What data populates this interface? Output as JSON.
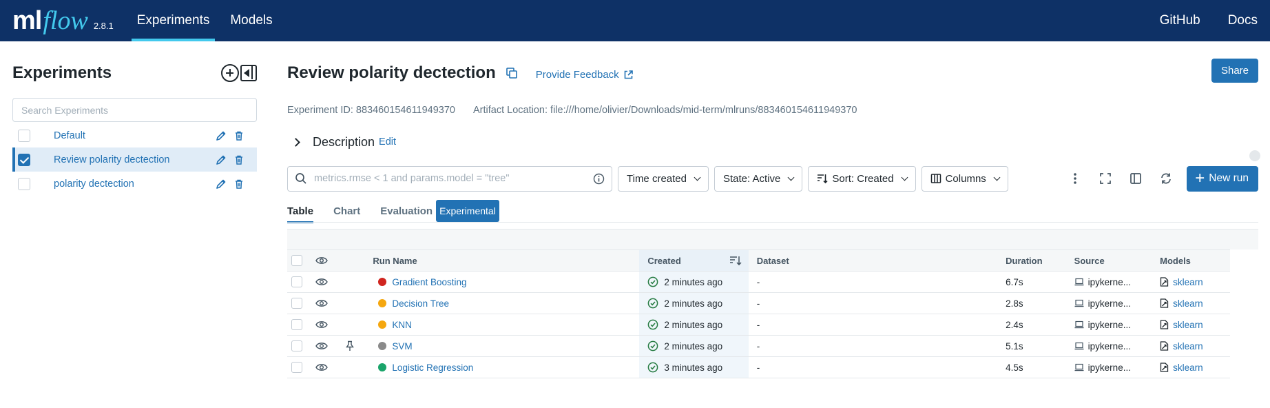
{
  "app": {
    "logo_ml": "ml",
    "logo_flow": "flow",
    "version": "2.8.1",
    "nav": [
      {
        "label": "Experiments",
        "active": true
      },
      {
        "label": "Models",
        "active": false
      }
    ],
    "links": {
      "github": "GitHub",
      "docs": "Docs"
    }
  },
  "sidebar": {
    "title": "Experiments",
    "search_placeholder": "Search Experiments",
    "experiments": [
      {
        "name": "Default",
        "checked": false,
        "selected": false
      },
      {
        "name": "Review polarity dectection",
        "checked": true,
        "selected": true
      },
      {
        "name": "polarity dectection",
        "checked": false,
        "selected": false
      }
    ]
  },
  "experiment": {
    "title": "Review polarity dectection",
    "feedback": "Provide Feedback",
    "share": "Share",
    "experiment_id": "Experiment ID: 883460154611949370",
    "artifact_location": "Artifact Location: file:///home/olivier/Downloads/mid-term/mlruns/883460154611949370",
    "description_label": "Description",
    "description_edit": "Edit"
  },
  "toolbar": {
    "search_placeholder": "metrics.rmse < 1 and params.model = \"tree\"",
    "time_created": "Time created",
    "state": "State: Active",
    "sort": "Sort: Created",
    "columns": "Columns",
    "new_run": "New run"
  },
  "tabs": {
    "table": "Table",
    "chart": "Chart",
    "evaluation": "Evaluation",
    "badge": "Experimental"
  },
  "table": {
    "headers": {
      "run_name": "Run Name",
      "created": "Created",
      "dataset": "Dataset",
      "duration": "Duration",
      "source": "Source",
      "models": "Models"
    },
    "rows": [
      {
        "name": "Gradient Boosting",
        "color": "#d0251f",
        "created": "2 minutes ago",
        "dataset": "-",
        "duration": "6.7s",
        "source": "ipykerne...",
        "model": "sklearn",
        "pinned": false
      },
      {
        "name": "Decision Tree",
        "color": "#f5a70f",
        "created": "2 minutes ago",
        "dataset": "-",
        "duration": "2.8s",
        "source": "ipykerne...",
        "model": "sklearn",
        "pinned": false
      },
      {
        "name": "KNN",
        "color": "#f5a70f",
        "created": "2 minutes ago",
        "dataset": "-",
        "duration": "2.4s",
        "source": "ipykerne...",
        "model": "sklearn",
        "pinned": false
      },
      {
        "name": "SVM",
        "color": "#8a8a8a",
        "created": "2 minutes ago",
        "dataset": "-",
        "duration": "5.1s",
        "source": "ipykerne...",
        "model": "sklearn",
        "pinned": true
      },
      {
        "name": "Logistic Regression",
        "color": "#1aa46a",
        "created": "3 minutes ago",
        "dataset": "-",
        "duration": "4.5s",
        "source": "ipykerne...",
        "model": "sklearn",
        "pinned": false
      }
    ]
  }
}
